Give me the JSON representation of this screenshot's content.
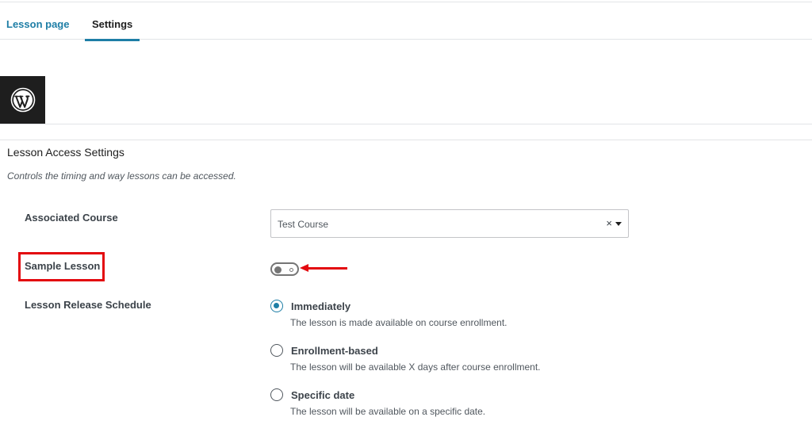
{
  "tabs": {
    "lesson_page": "Lesson page",
    "settings": "Settings"
  },
  "icons": {
    "logo": "wordpress-icon",
    "select_clear": "close-icon",
    "select_caret": "chevron-down-icon",
    "annotation_arrow": "arrow-left-icon"
  },
  "colors": {
    "accent": "#1e7ea6",
    "annotation": "#e3090f",
    "logo_bg": "#1e1e1e"
  },
  "panel": {
    "title": "Lesson Access Settings",
    "description": "Controls the timing and way lessons can be accessed."
  },
  "fields": {
    "associated_course": {
      "label": "Associated Course",
      "value": "Test Course",
      "clear_symbol": "×"
    },
    "sample_lesson": {
      "label": "Sample Lesson",
      "enabled": false
    },
    "release_schedule": {
      "label": "Lesson Release Schedule",
      "options": [
        {
          "label": "Immediately",
          "help": "The lesson is made available on course enrollment.",
          "checked": true
        },
        {
          "label": "Enrollment-based",
          "help": "The lesson will be available X days after course enrollment.",
          "checked": false
        },
        {
          "label": "Specific date",
          "help": "The lesson will be available on a specific date.",
          "checked": false
        }
      ]
    }
  }
}
